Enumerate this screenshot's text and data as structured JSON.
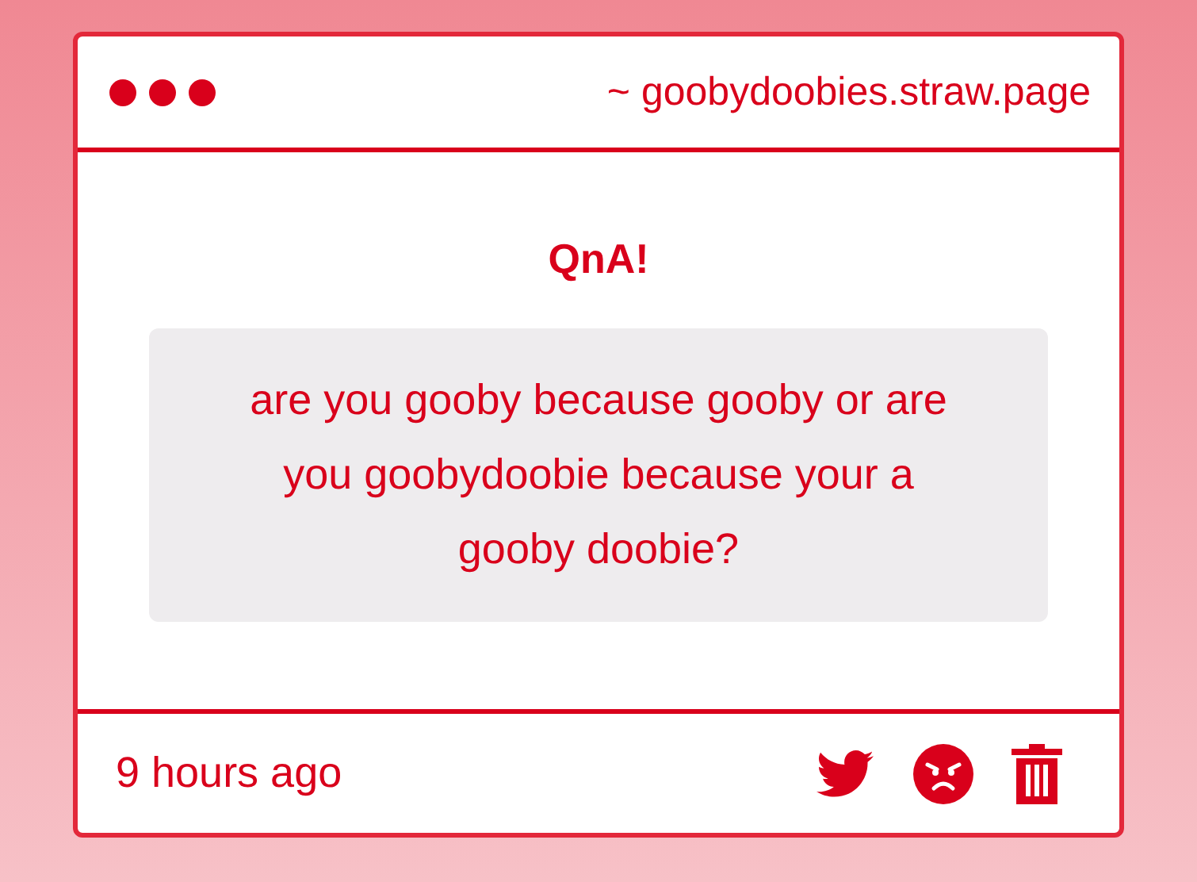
{
  "window": {
    "address": "~ goobydoobies.straw.page"
  },
  "card": {
    "title": "QnA!",
    "question": "are you gooby because gooby or are you goobydoobie because your a gooby doobie?"
  },
  "footer": {
    "time": "9 hours ago",
    "actions": [
      {
        "kind": "bird"
      },
      {
        "kind": "angry"
      },
      {
        "kind": "trash"
      }
    ]
  }
}
